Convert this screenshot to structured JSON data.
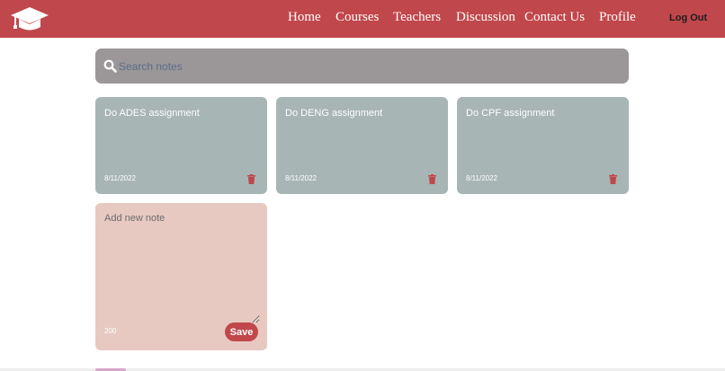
{
  "nav": {
    "links": [
      {
        "label": "Home"
      },
      {
        "label": "Courses"
      },
      {
        "label": "Teachers"
      },
      {
        "label": "Discussion"
      },
      {
        "label": "Contact Us"
      },
      {
        "label": "Profile"
      }
    ],
    "logout_label": "Log Out",
    "logo_icon": "graduation-cap-icon"
  },
  "search": {
    "placeholder": "Search notes",
    "value": "",
    "icon": "search-icon"
  },
  "notes": [
    {
      "text": "Do ADES assignment",
      "date": "8/11/2022"
    },
    {
      "text": "Do DENG assignment",
      "date": "8/11/2022"
    },
    {
      "text": "Do CPF assignment",
      "date": "8/11/2022"
    }
  ],
  "new_note": {
    "placeholder": "Add new note",
    "value": "",
    "chars_remaining": "200",
    "save_label": "Save"
  },
  "colors": {
    "brand": "#c0474b",
    "note_bg": "#a7b5b4",
    "new_note_bg": "#e7c9c1",
    "search_bg": "#9b9798"
  }
}
